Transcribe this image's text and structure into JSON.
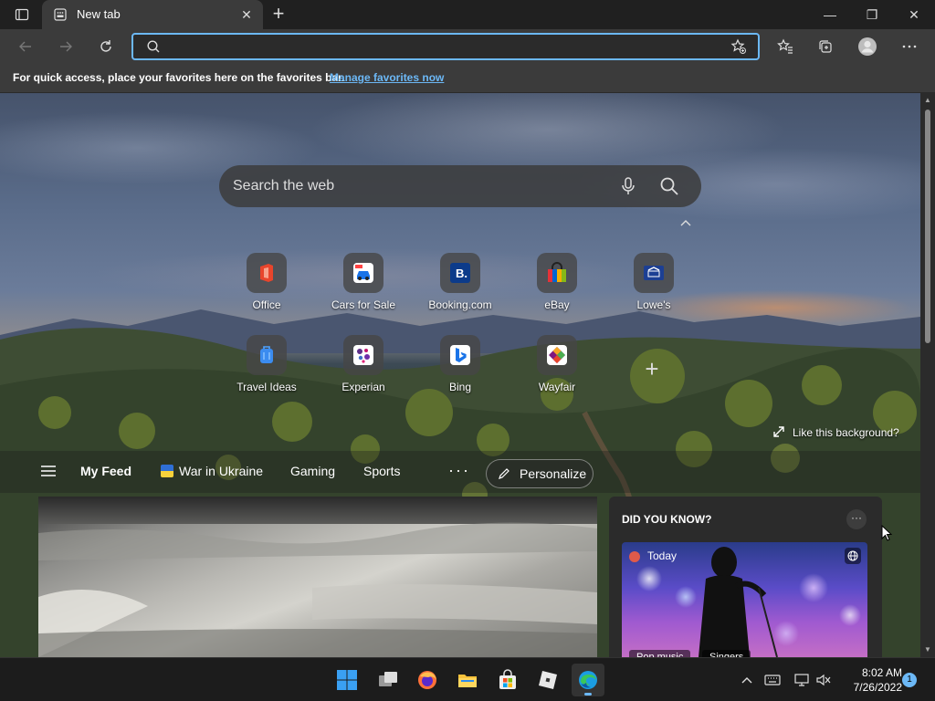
{
  "browser": {
    "tab": {
      "title": "New tab",
      "close_glyph": "✕"
    },
    "new_tab_glyph": "+",
    "window": {
      "minimize": "—",
      "restore": "❐",
      "close": "✕"
    },
    "address": {
      "value": "",
      "placeholder": ""
    },
    "favbar": {
      "text": "For quick access, place your favorites here on the favorites bar.",
      "link": "Manage favorites now"
    }
  },
  "newtab": {
    "search_placeholder": "Search the web",
    "tiles": [
      {
        "label": "Office",
        "icon": "office-icon"
      },
      {
        "label": "Cars for Sale",
        "icon": "car-icon"
      },
      {
        "label": "Booking.com",
        "icon": "booking-icon"
      },
      {
        "label": "eBay",
        "icon": "ebay-bag-icon"
      },
      {
        "label": "Lowe's",
        "icon": "lowes-icon"
      },
      {
        "label": "Travel Ideas",
        "icon": "luggage-icon"
      },
      {
        "label": "Experian",
        "icon": "experian-icon"
      },
      {
        "label": "Bing",
        "icon": "bing-icon"
      },
      {
        "label": "Wayfair",
        "icon": "wayfair-icon"
      }
    ],
    "add_tile_glyph": "+",
    "like_background": "Like this background?",
    "feed": {
      "items": [
        "My Feed",
        "War in Ukraine",
        "Gaming",
        "Sports"
      ],
      "more": "···",
      "personalize": "Personalize"
    },
    "did_you_know": {
      "title": "DID YOU KNOW?",
      "more": "···",
      "today": "Today",
      "tags": [
        "Pop music",
        "Singers"
      ]
    }
  },
  "taskbar": {
    "time": "8:02 AM",
    "date": "7/26/2022",
    "notification_count": "1"
  },
  "colors": {
    "accent": "#6cb8f6",
    "titlebar": "#202020",
    "toolbar": "#3b3b3b"
  }
}
